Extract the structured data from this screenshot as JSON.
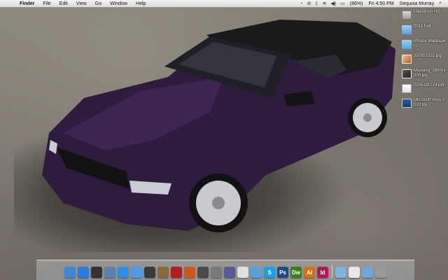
{
  "menubar": {
    "apple_icon": "apple-icon",
    "items": [
      "Finder",
      "File",
      "Edit",
      "View",
      "Go",
      "Window",
      "Help"
    ],
    "battery": "(86%)",
    "clock": "Fri 4:50 PM",
    "user": "Sequoia Murray",
    "status_icons": [
      "timer-icon",
      "sync-icon",
      "bluetooth-icon",
      "wifi-icon",
      "volume-icon",
      "battery-icon",
      "search-icon"
    ]
  },
  "desktop": {
    "items": [
      {
        "label": "Macintosh HD",
        "kind": "hd"
      },
      {
        "label": "2011 Fall",
        "kind": "folder"
      },
      {
        "label": "iPhone Wallpapers",
        "kind": "folder"
      },
      {
        "label": "397857332.jpg",
        "kind": "image"
      },
      {
        "label": "Mustang_1600x1200.jpg",
        "kind": "image2"
      },
      {
        "label": "0205181074.pdf",
        "kind": "pdf"
      },
      {
        "label": "Microsoft Visio 2010.lnk",
        "kind": "visio"
      }
    ]
  },
  "dock": {
    "items": [
      {
        "name": "finder-icon",
        "glyph": "",
        "color": "#3f86d6"
      },
      {
        "name": "app-store-icon",
        "glyph": "",
        "color": "#2a7be0"
      },
      {
        "name": "dashboard-icon",
        "glyph": "",
        "color": "#333333"
      },
      {
        "name": "preview-icon",
        "glyph": "",
        "color": "#5d7fa8"
      },
      {
        "name": "safari-icon",
        "glyph": "",
        "color": "#2f8fe6"
      },
      {
        "name": "ichat-icon",
        "glyph": "",
        "color": "#4d9be8"
      },
      {
        "name": "facetime-icon",
        "glyph": "",
        "color": "#3a3a3a"
      },
      {
        "name": "address-book-icon",
        "glyph": "",
        "color": "#8a6a3c"
      },
      {
        "name": "photo-booth-icon",
        "glyph": "",
        "color": "#b12020"
      },
      {
        "name": "iphoto-icon",
        "glyph": "",
        "color": "#c85a1e"
      },
      {
        "name": "garageband-icon",
        "glyph": "",
        "color": "#4a4a4a"
      },
      {
        "name": "time-machine-icon",
        "glyph": "",
        "color": "#7a7a7a"
      },
      {
        "name": "photoshop-brush-icon",
        "glyph": "",
        "color": "#5a5a9a"
      },
      {
        "name": "chrome-icon",
        "glyph": "",
        "color": "#e0e0e0"
      },
      {
        "name": "itunes-icon",
        "glyph": "",
        "color": "#5aa0e0"
      },
      {
        "name": "skype-icon",
        "glyph": "S",
        "color": "#1aa0e8"
      },
      {
        "name": "photoshop-icon",
        "glyph": "Ps",
        "color": "#1d4a86"
      },
      {
        "name": "dreamweaver-icon",
        "glyph": "Dw",
        "color": "#3c7a1e"
      },
      {
        "name": "illustrator-icon",
        "glyph": "Ai",
        "color": "#d8700a"
      },
      {
        "name": "indesign-icon",
        "glyph": "Id",
        "color": "#b0185a"
      },
      {
        "name": "applications-folder-icon",
        "glyph": "",
        "color": "#7fb3dc"
      },
      {
        "name": "documents-stack-icon",
        "glyph": "",
        "color": "#e8e8e8"
      },
      {
        "name": "downloads-folder-icon",
        "glyph": "",
        "color": "#6fa6d6"
      },
      {
        "name": "trash-icon",
        "glyph": "",
        "color": "#9a9a9a"
      }
    ]
  },
  "wallpaper": {
    "subject": "purple-mustang-convertible-image",
    "car_color": "#2e1b3d",
    "roof_color": "#1a1a1c"
  }
}
